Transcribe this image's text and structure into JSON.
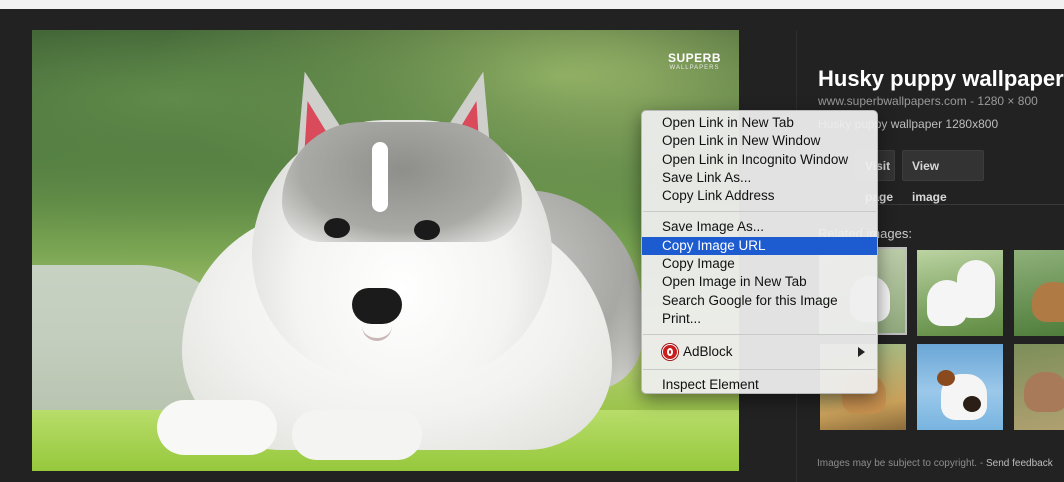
{
  "logo": {
    "main": "SUPERB",
    "sub": "WALLPAPERS"
  },
  "info": {
    "title": "Husky puppy wallpaper",
    "meta": "www.superbwallpapers.com - 1280 × 800",
    "description": "Husky puppy wallpaper 1280x800",
    "visit_button": "Visit page",
    "view_button": "View image"
  },
  "related": {
    "label": "Related images:"
  },
  "copyright": {
    "text": "Images may be subject to copyright.",
    "feedback": "Send feedback"
  },
  "context_menu": {
    "items": [
      "Open Link in New Tab",
      "Open Link in New Window",
      "Open Link in Incognito Window",
      "Save Link As...",
      "Copy Link Address",
      "Save Image As...",
      "Copy Image URL",
      "Copy Image",
      "Open Image in New Tab",
      "Search Google for this Image",
      "Print...",
      "AdBlock",
      "Inspect Element"
    ],
    "highlighted": "Copy Image URL",
    "highlight_color": "#1d5bd1"
  }
}
